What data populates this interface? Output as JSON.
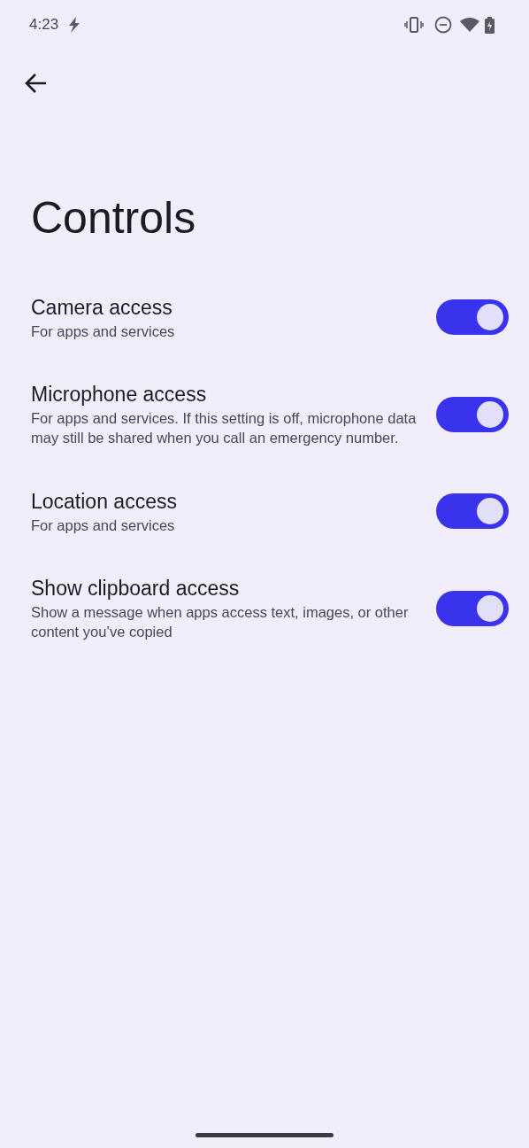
{
  "status_bar": {
    "time": "4:23"
  },
  "title": "Controls",
  "settings": [
    {
      "title": "Camera access",
      "summary": "For apps and services",
      "on": true
    },
    {
      "title": "Microphone access",
      "summary": "For apps and services. If this setting is off, microphone data may still be shared when you call an emergency number.",
      "on": true
    },
    {
      "title": "Location access",
      "summary": "For apps and services",
      "on": true
    },
    {
      "title": "Show clipboard access",
      "summary": "Show a message when apps access text, images, or other content you’ve copied",
      "on": true
    }
  ]
}
